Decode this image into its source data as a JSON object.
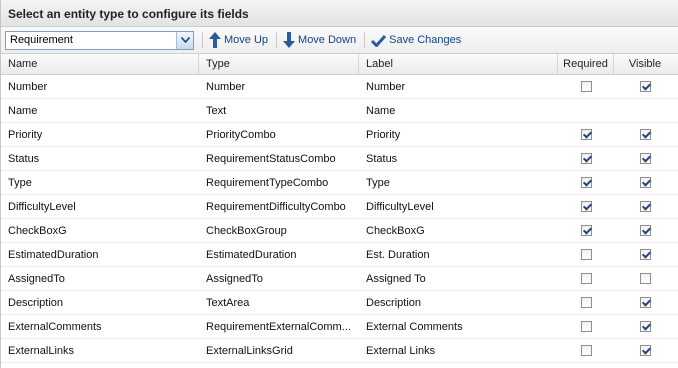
{
  "panel": {
    "title": "Select an entity type to configure its fields"
  },
  "toolbar": {
    "entity_value": "Requirement",
    "move_up_label": "Move Up",
    "move_down_label": "Move Down",
    "save_label": "Save Changes"
  },
  "grid": {
    "columns": {
      "name": "Name",
      "type": "Type",
      "label": "Label",
      "required": "Required",
      "visible": "Visible"
    },
    "rows": [
      {
        "name": "Number",
        "type": "Number",
        "label": "Number",
        "required": false,
        "visible": true,
        "has_required": true,
        "has_visible": true
      },
      {
        "name": "Name",
        "type": "Text",
        "label": "Name",
        "required": false,
        "visible": false,
        "has_required": false,
        "has_visible": false
      },
      {
        "name": "Priority",
        "type": "PriorityCombo",
        "label": "Priority",
        "required": true,
        "visible": true,
        "has_required": true,
        "has_visible": true
      },
      {
        "name": "Status",
        "type": "RequirementStatusCombo",
        "label": "Status",
        "required": true,
        "visible": true,
        "has_required": true,
        "has_visible": true
      },
      {
        "name": "Type",
        "type": "RequirementTypeCombo",
        "label": "Type",
        "required": true,
        "visible": true,
        "has_required": true,
        "has_visible": true
      },
      {
        "name": "DifficultyLevel",
        "type": "RequirementDifficultyCombo",
        "label": "DifficultyLevel",
        "required": true,
        "visible": true,
        "has_required": true,
        "has_visible": true
      },
      {
        "name": "CheckBoxG",
        "type": "CheckBoxGroup",
        "label": "CheckBoxG",
        "required": true,
        "visible": true,
        "has_required": true,
        "has_visible": true
      },
      {
        "name": "EstimatedDuration",
        "type": "EstimatedDuration",
        "label": "Est. Duration",
        "required": false,
        "visible": true,
        "has_required": true,
        "has_visible": true
      },
      {
        "name": "AssignedTo",
        "type": "AssignedTo",
        "label": "Assigned To",
        "required": false,
        "visible": false,
        "has_required": true,
        "has_visible": true
      },
      {
        "name": "Description",
        "type": "TextArea",
        "label": "Description",
        "required": false,
        "visible": true,
        "has_required": true,
        "has_visible": true
      },
      {
        "name": "ExternalComments",
        "type": "RequirementExternalComm...",
        "label": "External Comments",
        "required": false,
        "visible": true,
        "has_required": true,
        "has_visible": true
      },
      {
        "name": "ExternalLinks",
        "type": "ExternalLinksGrid",
        "label": "External Links",
        "required": false,
        "visible": true,
        "has_required": true,
        "has_visible": true
      }
    ]
  },
  "colors": {
    "link_blue": "#15428b",
    "check_blue": "#2b3f8f"
  }
}
